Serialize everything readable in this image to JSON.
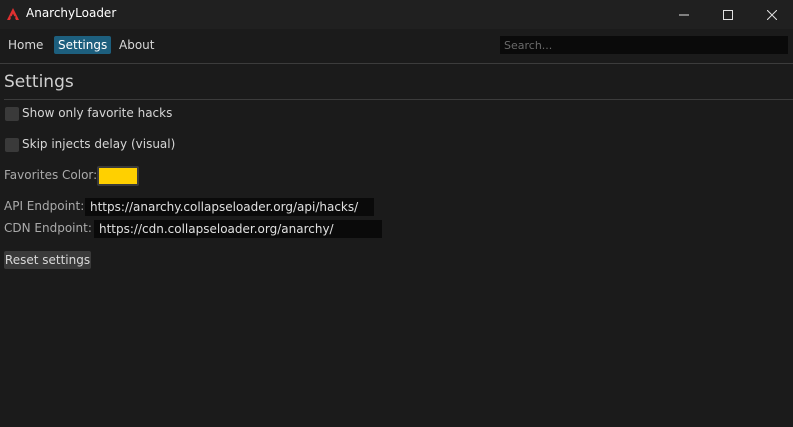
{
  "window": {
    "title": "AnarchyLoader",
    "logo_icon": "anarchy-logo-icon",
    "controls": [
      "minimize-icon",
      "maximize-icon",
      "close-icon"
    ],
    "accent_color": "#e03030"
  },
  "menu": {
    "home": "Home",
    "settings": "Settings",
    "about": "About",
    "active": "Settings",
    "active_color": "#1d5f7e"
  },
  "search": {
    "placeholder": "Search...",
    "value": ""
  },
  "settings": {
    "title": "Settings",
    "show_favorites_label": "Show only favorite hacks",
    "show_favorites_checked": false,
    "skip_delay_label": "Skip injects delay (visual)",
    "skip_delay_checked": false,
    "favorites_color_label": "Favorites Color:",
    "favorites_color": "#ffd000",
    "api_label": "API Endpoint:",
    "api_value": "https://anarchy.collapseloader.org/api/hacks/",
    "cdn_label": "CDN Endpoint:",
    "cdn_value": "https://cdn.collapseloader.org/anarchy/",
    "reset_label": "Reset settings"
  }
}
